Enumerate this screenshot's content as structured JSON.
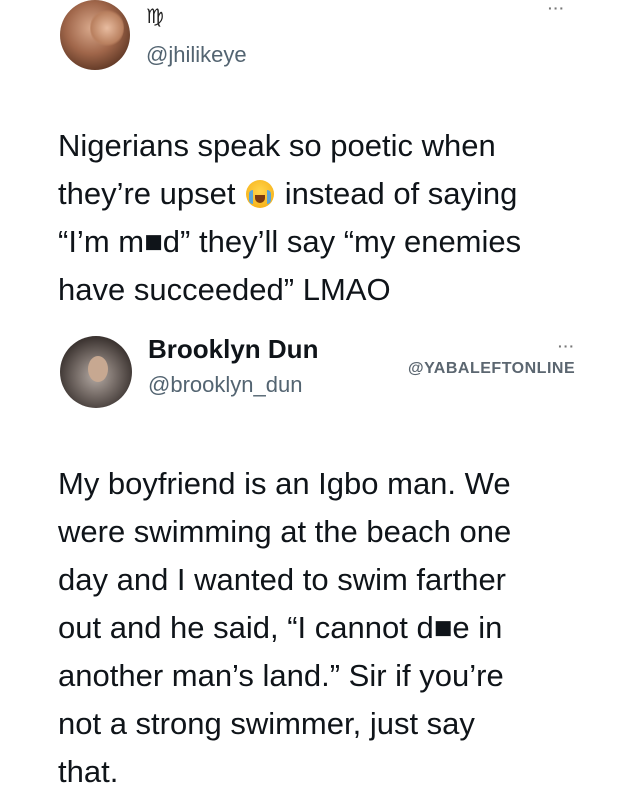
{
  "tweet1": {
    "zodiac": "♍",
    "handle": "@jhilikeye",
    "more": "···",
    "lines": {
      "l1": "Nigerians speak so poetic when",
      "l2a": "they’re upset",
      "l2b": "instead of saying",
      "l3": "“I’m m■d” they’ll say “my enemies",
      "l4": "have succeeded” LMAO"
    },
    "emoji": "loudly-crying-face"
  },
  "tweet2": {
    "name": "Brooklyn Dun",
    "handle": "@brooklyn_dun",
    "watermark": "@YABALEFTONLINE",
    "more": "···",
    "lines": {
      "l1": "My boyfriend is an Igbo man. We",
      "l2": "were swimming at the beach one",
      "l3": "day and I wanted to swim farther",
      "l4": "out and he said, “I cannot d■e in",
      "l5": "another man’s land.” Sir if you’re",
      "l6": "not a strong swimmer, just say",
      "l7": "that."
    }
  }
}
